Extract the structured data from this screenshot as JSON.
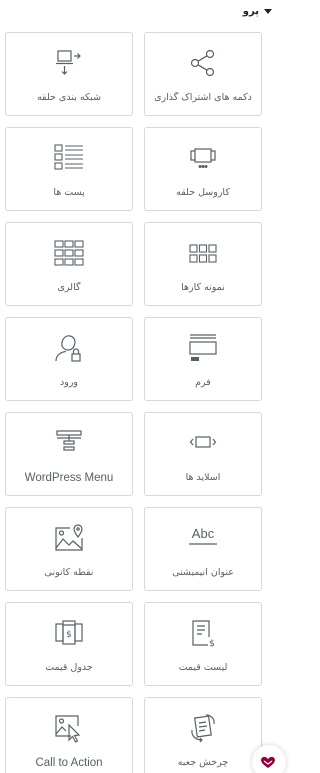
{
  "section": {
    "title": "پرو"
  },
  "widgets": [
    {
      "label": "شبکه بندی حلقه",
      "icon": "loop-grid-icon"
    },
    {
      "label": "دکمه های اشتراک گذاری",
      "icon": "share-icon"
    },
    {
      "label": "پست ها",
      "icon": "posts-icon"
    },
    {
      "label": "کاروسل حلقه",
      "icon": "loop-carousel-icon"
    },
    {
      "label": "گالری",
      "icon": "gallery-icon"
    },
    {
      "label": "نمونه کارها",
      "icon": "portfolio-icon"
    },
    {
      "label": "ورود",
      "icon": "login-icon"
    },
    {
      "label": "فرم",
      "icon": "form-icon"
    },
    {
      "label": "WordPress Menu",
      "icon": "wordpress-menu-icon"
    },
    {
      "label": "اسلاید ها",
      "icon": "slides-icon"
    },
    {
      "label": "نقطه کانونی",
      "icon": "hotspot-icon"
    },
    {
      "label": "عنوان انیمیشنی",
      "icon": "animated-headline-icon"
    },
    {
      "label": "جدول قیمت",
      "icon": "price-table-icon"
    },
    {
      "label": "لیست قیمت",
      "icon": "price-list-icon"
    },
    {
      "label": "Call to Action",
      "icon": "call-to-action-icon"
    },
    {
      "label": "چرخش جعبه",
      "icon": "flip-box-icon"
    }
  ],
  "icon_text": {
    "abc": "Abc",
    "dollar": "$"
  },
  "colors": {
    "icon": "#556068",
    "border": "#d5d8dc",
    "badge": "#93003f"
  }
}
